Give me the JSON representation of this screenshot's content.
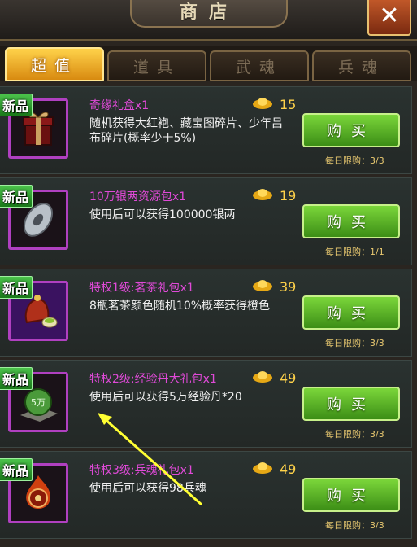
{
  "header": {
    "title": "商店",
    "close_label": "✕"
  },
  "tabs": [
    {
      "label": "超值",
      "active": true
    },
    {
      "label": "道具",
      "active": false
    },
    {
      "label": "武魂",
      "active": false
    },
    {
      "label": "兵魂",
      "active": false
    }
  ],
  "items": [
    {
      "tag": "新品",
      "name": "奇缘礼盒x1",
      "price": "15",
      "desc": "随机获得大红袍、藏宝图碎片、少年吕布碎片(概率少于5%)",
      "buy_label": "购买",
      "limit": "每日限购：3/3",
      "icon": "gift-box-icon"
    },
    {
      "tag": "新品",
      "name": "10万银两资源包x1",
      "price": "19",
      "desc": "使用后可以获得100000银两",
      "buy_label": "购买",
      "limit": "每日限购：1/1",
      "icon": "silver-coin-icon"
    },
    {
      "tag": "新品",
      "name": "特权1级:茗茶礼包x1",
      "price": "39",
      "desc": "8瓶茗茶颜色随机10%概率获得橙色",
      "buy_label": "购买",
      "limit": "每日限购：3/3",
      "icon": "tea-bag-icon"
    },
    {
      "tag": "新品",
      "name": "特权2级:经验丹大礼包x1",
      "price": "49",
      "desc": "使用后可以获得5万经验丹*20",
      "buy_label": "购买",
      "limit": "每日限购：3/3",
      "icon": "exp-pill-icon"
    },
    {
      "tag": "新品",
      "name": "特权3级:兵魂礼包x1",
      "price": "49",
      "desc": "使用后可以获得98兵魂",
      "buy_label": "购买",
      "limit": "每日限购：3/3",
      "icon": "soldier-soul-icon"
    }
  ],
  "exp_pill_label": "5万",
  "colors": {
    "item_name": "#e04ad8",
    "price": "#ffd24a",
    "buy_button": "#5bb52a",
    "annotation_arrow": "#ffff33"
  }
}
